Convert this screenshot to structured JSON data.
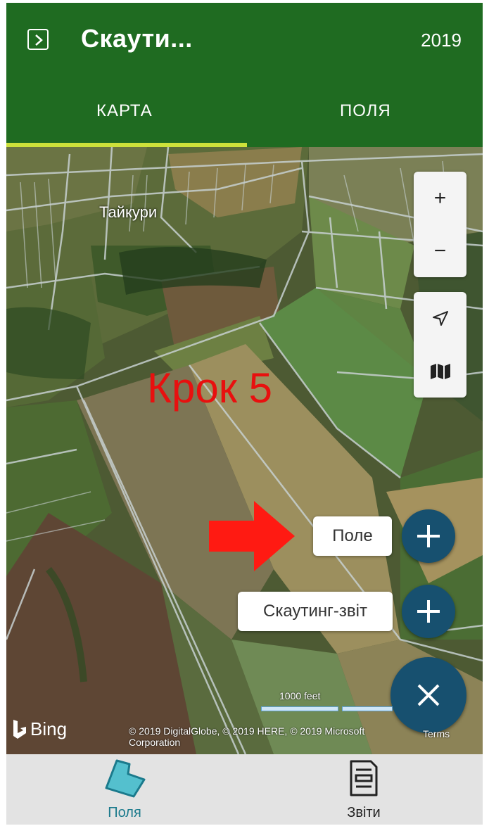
{
  "header": {
    "menu_icon": "chevron-right-icon",
    "title": "Скаути...",
    "year": "2019",
    "tabs": [
      {
        "label": "КАРТА",
        "active": true
      },
      {
        "label": "ПОЛЯ",
        "active": false
      }
    ],
    "accent_color": "#cde13a",
    "bar_color": "#1f6b21"
  },
  "map": {
    "place_label": "Тайкури",
    "zoom_in_label": "+",
    "zoom_out_label": "−",
    "locate_icon": "navigation-arrow-icon",
    "layers_icon": "map-layers-icon",
    "overlay_text": "Крок 5",
    "overlay_color": "#e8100f",
    "scale_label": "1000 feet",
    "provider": "Bing",
    "attribution": "© 2019 DigitalGlobe, © 2019 HERE, © 2019 Microsoft Corporation",
    "terms": "Terms"
  },
  "actions": {
    "field_label": "Поле",
    "scout_label": "Скаутинг-звіт",
    "add_icon": "plus-icon",
    "close_icon": "close-icon",
    "fab_color": "#17506f"
  },
  "bottom_nav": {
    "items": [
      {
        "label": "Поля",
        "icon": "field-polygon-icon",
        "active": true
      },
      {
        "label": "Звіти",
        "icon": "report-document-icon",
        "active": false
      }
    ]
  }
}
